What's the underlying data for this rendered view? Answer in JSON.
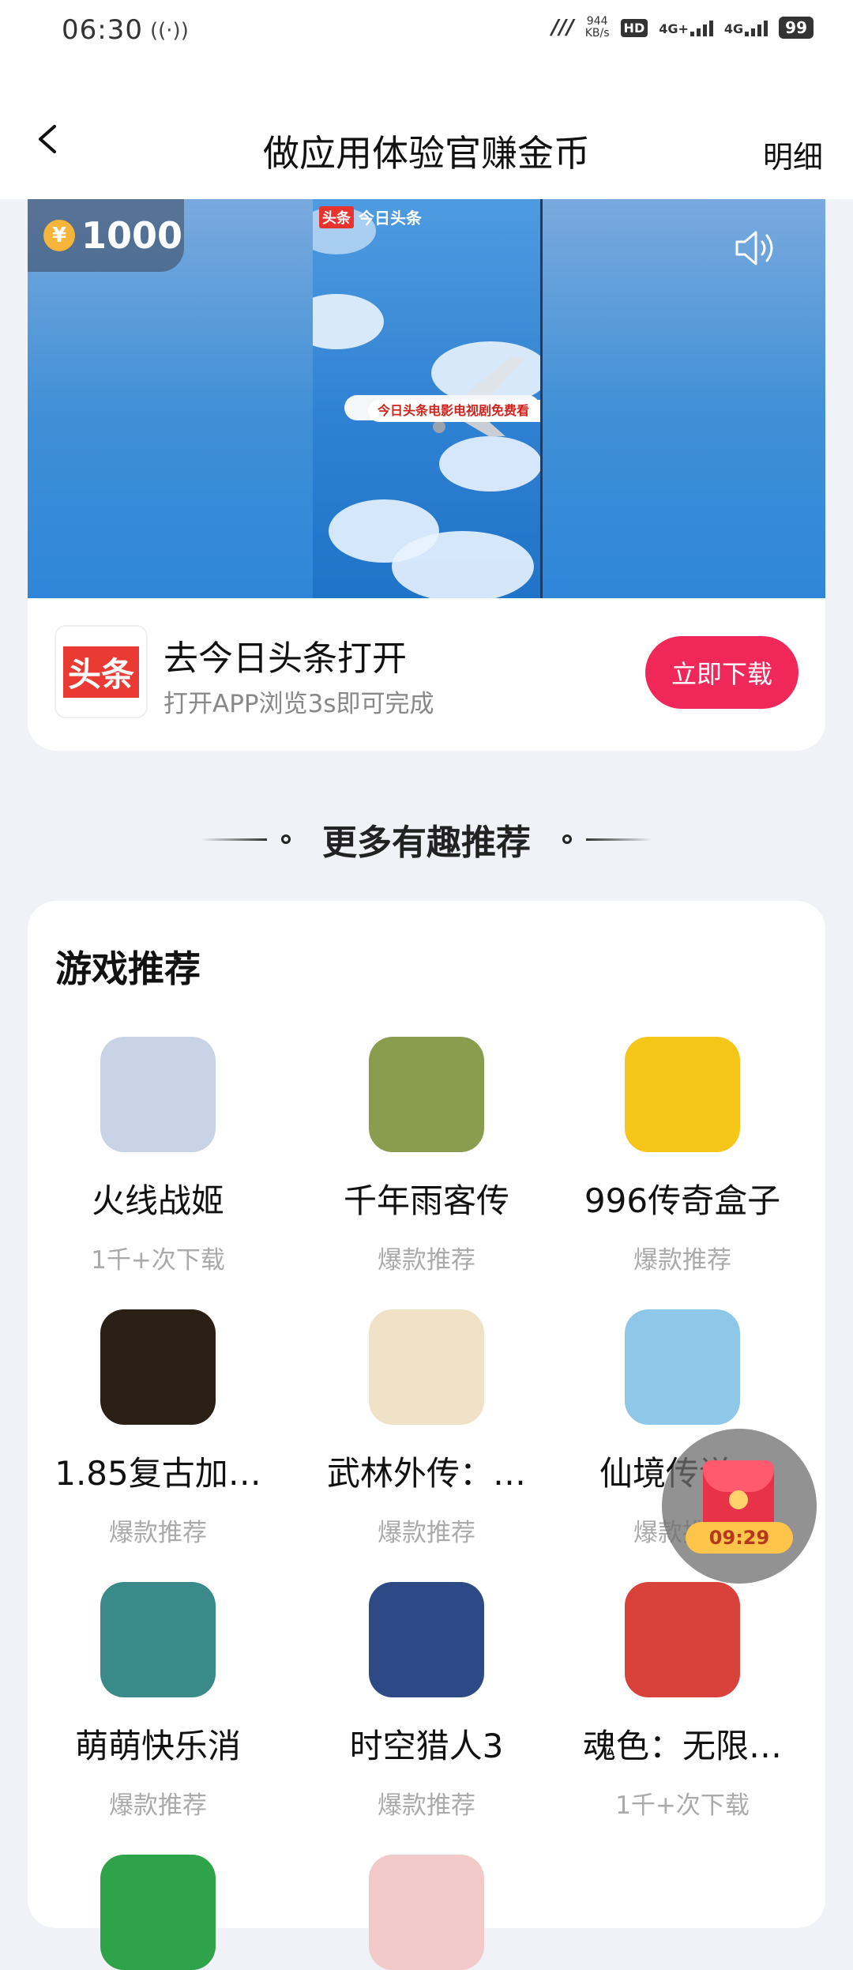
{
  "status_bar": {
    "time": "06:30",
    "network_speed": "944",
    "network_speed_unit": "KB/s",
    "hd": "HD",
    "signal_1": "4G+",
    "signal_2": "4G",
    "battery": "99"
  },
  "header": {
    "back_icon": "chevron-left-icon",
    "title": "做应用体验官赚金币",
    "detail_label": "明细"
  },
  "ad": {
    "coin_amount": "1000",
    "coin_symbol": "¥",
    "video_brand_logo": "头条",
    "video_brand": "今日头条",
    "plane_banner_text": "今日头条电影电视剧免费看",
    "sound_icon": "speaker-icon",
    "app_logo_text": "头条",
    "app_title": "去今日头条打开",
    "app_subtitle": "打开APP浏览3s即可完成",
    "download_label": "立即下载"
  },
  "section": {
    "title": "更多有趣推荐"
  },
  "games": {
    "title": "游戏推荐",
    "items": [
      {
        "name": "火线战姬",
        "tag": "1千+次下载",
        "color": "#c9d3e6"
      },
      {
        "name": "千年雨客传",
        "tag": "爆款推荐",
        "color": "#8a9c4e"
      },
      {
        "name": "996传奇盒子",
        "tag": "爆款推荐",
        "color": "#f5c518"
      },
      {
        "name": "1.85复古加…",
        "tag": "爆款推荐",
        "color": "#2b2015"
      },
      {
        "name": "武林外传：…",
        "tag": "爆款推荐",
        "color": "#efe2c6"
      },
      {
        "name": "仙境传说…",
        "tag": "爆款推荐",
        "color": "#8fc7e8"
      },
      {
        "name": "萌萌快乐消",
        "tag": "爆款推荐",
        "color": "#3a8a8a"
      },
      {
        "name": "时空猎人3",
        "tag": "爆款推荐",
        "color": "#2d4a86"
      },
      {
        "name": "魂色：无限…",
        "tag": "1千+次下载",
        "color": "#d8423a"
      },
      {
        "name": "",
        "tag": "",
        "color": "#2fa34a"
      },
      {
        "name": "",
        "tag": "",
        "color": "#f2c9c9"
      }
    ]
  },
  "floating": {
    "timer": "09:29",
    "icon": "red-packet-icon"
  }
}
